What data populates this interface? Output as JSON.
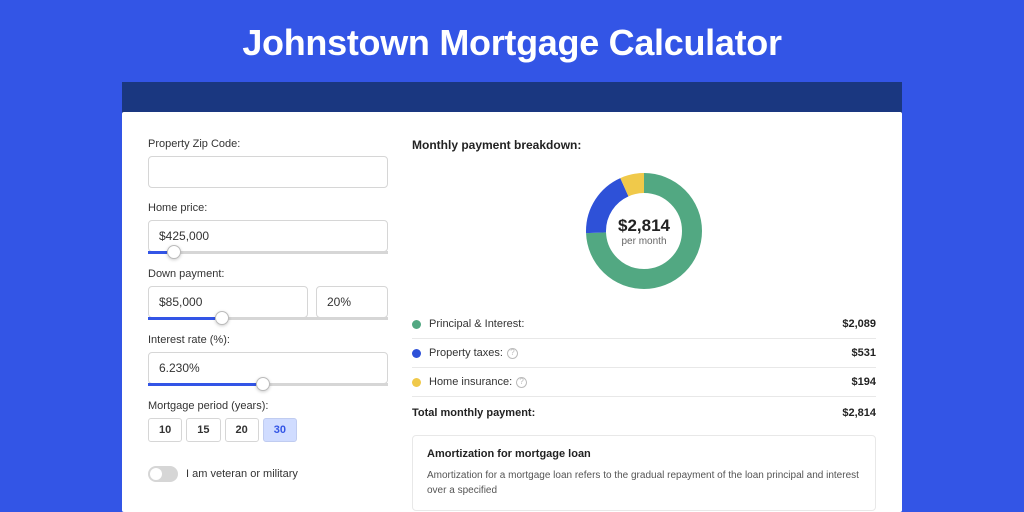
{
  "title": "Johnstown Mortgage Calculator",
  "form": {
    "zip": {
      "label": "Property Zip Code:",
      "value": ""
    },
    "home_price": {
      "label": "Home price:",
      "value": "$425,000",
      "slider_pct": 8
    },
    "down_payment": {
      "label": "Down payment:",
      "value": "$85,000",
      "pct_value": "20%",
      "slider_pct": 28
    },
    "interest": {
      "label": "Interest rate (%):",
      "value": "6.230%",
      "slider_pct": 45
    },
    "period": {
      "label": "Mortgage period (years):",
      "options": [
        "10",
        "15",
        "20",
        "30"
      ],
      "active": "30"
    },
    "veteran": {
      "label": "I am veteran or military"
    }
  },
  "breakdown": {
    "title": "Monthly payment breakdown:",
    "center_amount": "$2,814",
    "center_sub": "per month",
    "items": [
      {
        "label": "Principal & Interest:",
        "value": "$2,089",
        "color": "#52a882",
        "info": false
      },
      {
        "label": "Property taxes:",
        "value": "$531",
        "color": "#2e51d8",
        "info": true
      },
      {
        "label": "Home insurance:",
        "value": "$194",
        "color": "#f0c94a",
        "info": true
      }
    ],
    "total": {
      "label": "Total monthly payment:",
      "value": "$2,814"
    }
  },
  "amortization": {
    "title": "Amortization for mortgage loan",
    "text": "Amortization for a mortgage loan refers to the gradual repayment of the loan principal and interest over a specified"
  },
  "chart_data": {
    "type": "pie",
    "title": "Monthly payment breakdown",
    "series": [
      {
        "name": "Principal & Interest",
        "value": 2089,
        "color": "#52a882"
      },
      {
        "name": "Property taxes",
        "value": 531,
        "color": "#2e51d8"
      },
      {
        "name": "Home insurance",
        "value": 194,
        "color": "#f0c94a"
      }
    ],
    "total": 2814
  }
}
